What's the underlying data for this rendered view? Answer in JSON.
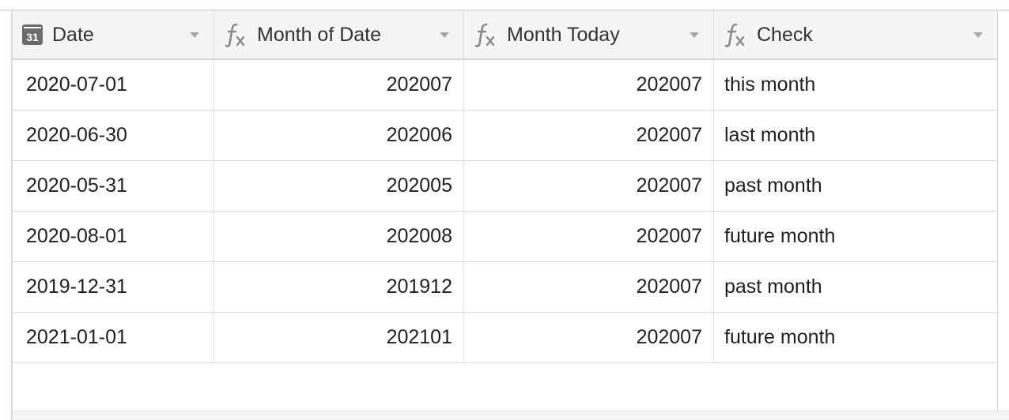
{
  "table": {
    "columns": [
      {
        "label": "Date",
        "icon": "calendar-icon",
        "icon_text": "31",
        "align": "left"
      },
      {
        "label": "Month of Date",
        "icon": "formula-icon",
        "align": "right"
      },
      {
        "label": "Month Today",
        "icon": "formula-icon",
        "align": "right"
      },
      {
        "label": "Check",
        "icon": "formula-icon",
        "align": "left"
      }
    ],
    "rows": [
      [
        "2020-07-01",
        "202007",
        "202007",
        "this month"
      ],
      [
        "2020-06-30",
        "202006",
        "202007",
        "last month"
      ],
      [
        "2020-05-31",
        "202005",
        "202007",
        "past month"
      ],
      [
        "2020-08-01",
        "202008",
        "202007",
        "future month"
      ],
      [
        "2019-12-31",
        "201912",
        "202007",
        "past month"
      ],
      [
        "2021-01-01",
        "202101",
        "202007",
        "future month"
      ]
    ]
  },
  "colors": {
    "header_bg": "#f5f5f5",
    "icon_gray": "#6b6b6b",
    "border": "#dcdcdc"
  }
}
